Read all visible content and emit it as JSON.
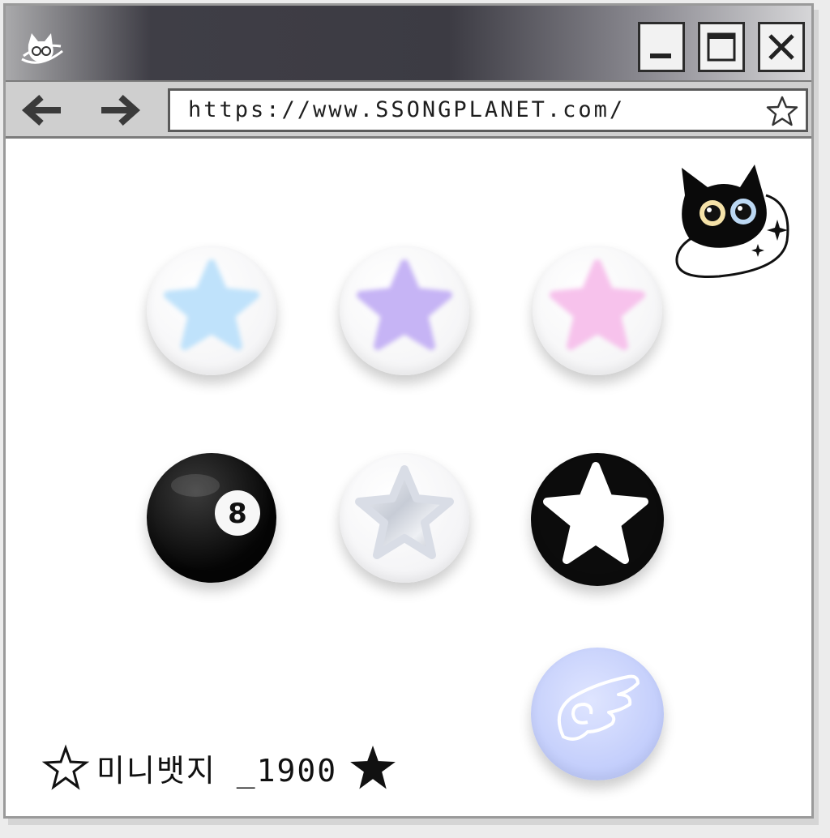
{
  "window": {
    "controls": {
      "minimize_label": "minimize",
      "maximize_label": "maximize",
      "close_label": "close"
    }
  },
  "toolbar": {
    "url": "https://www.SSONGPLANET.com/"
  },
  "icons": {
    "app_logo": "cat-planet-icon",
    "back": "arrow-left-icon",
    "forward": "arrow-right-icon",
    "bookmark": "star-outline-icon",
    "mascot": "black-cat-icon"
  },
  "badges": [
    {
      "name": "blue-star-badge",
      "color": "#bfe2fb"
    },
    {
      "name": "purple-star-badge",
      "color": "#c6b4f5"
    },
    {
      "name": "pink-star-badge",
      "color": "#f7c2ec"
    },
    {
      "name": "eight-ball-badge",
      "number": "8"
    },
    {
      "name": "silver-star-badge",
      "color": "#d9dde6"
    },
    {
      "name": "black-white-star-badge",
      "color": "#0c0c0c"
    },
    {
      "name": "angel-wing-badge",
      "color": "#c1ccfb"
    }
  ],
  "product": {
    "label": "미니뱃지 _1900"
  }
}
